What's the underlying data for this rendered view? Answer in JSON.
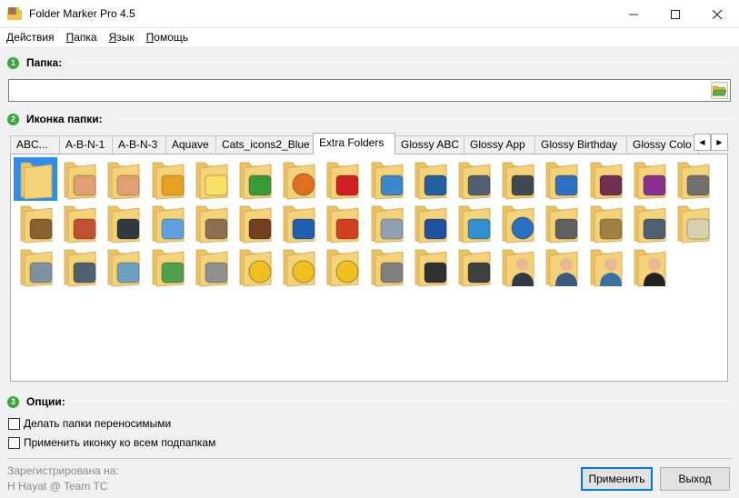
{
  "window": {
    "title": "Folder Marker Pro 4.5"
  },
  "menu": [
    "Действия",
    "Папка",
    "Язык",
    "Помощь"
  ],
  "sections": {
    "folder": {
      "num": "1",
      "title": "Папка:"
    },
    "icon": {
      "num": "2",
      "title": "Иконка папки:"
    },
    "options": {
      "num": "3",
      "title": "Опции:"
    }
  },
  "folder_path": {
    "value": ""
  },
  "tabs": [
    "ABC...",
    "A-B-N-1",
    "A-B-N-3",
    "Aquave",
    "Cats_icons2_Blue",
    "Extra Folders",
    "Glossy ABC",
    "Glossy App",
    "Glossy Birthday",
    "Glossy Colo"
  ],
  "active_tab": "Extra Folders",
  "icons": [
    "blank-folder",
    "thumbs-up",
    "thumbs-down",
    "beer-mug",
    "light-bulb",
    "shopping-cart",
    "basketball",
    "red-car",
    "truck",
    "monitor",
    "laptop",
    "server-tower",
    "database",
    "glasses",
    "eyeglass-frame",
    "cat",
    "dog",
    "house",
    "office-chair",
    "chat-bubbles",
    "donkey",
    "wordpress-book",
    "blue-book",
    "java-cup",
    "flowchart",
    "math-formula",
    "cubes",
    "help-circle",
    "tools",
    "scales",
    "calculator",
    "skull",
    "keys",
    "microscope",
    "magnifier",
    "medical-caduceus",
    "usb-stick",
    "smiley-happy",
    "smiley-sad",
    "smiley-wow",
    "radio",
    "tv",
    "webcam",
    "businessman",
    "man",
    "woman",
    "woman-dark"
  ],
  "options": {
    "portable": "Делать папки переносимыми",
    "subfolders": "Применить иконку ко всем подпапкам"
  },
  "footer": {
    "registered_label": "Зарегистрирована на:",
    "registered_to": "H Hayat @ Team TC",
    "apply_button": "Применить",
    "exit_button": "Выход"
  },
  "colors": {
    "step_badge": "#3aa63a",
    "selected": "#2e8ef0",
    "folder": "#f4d27a"
  }
}
